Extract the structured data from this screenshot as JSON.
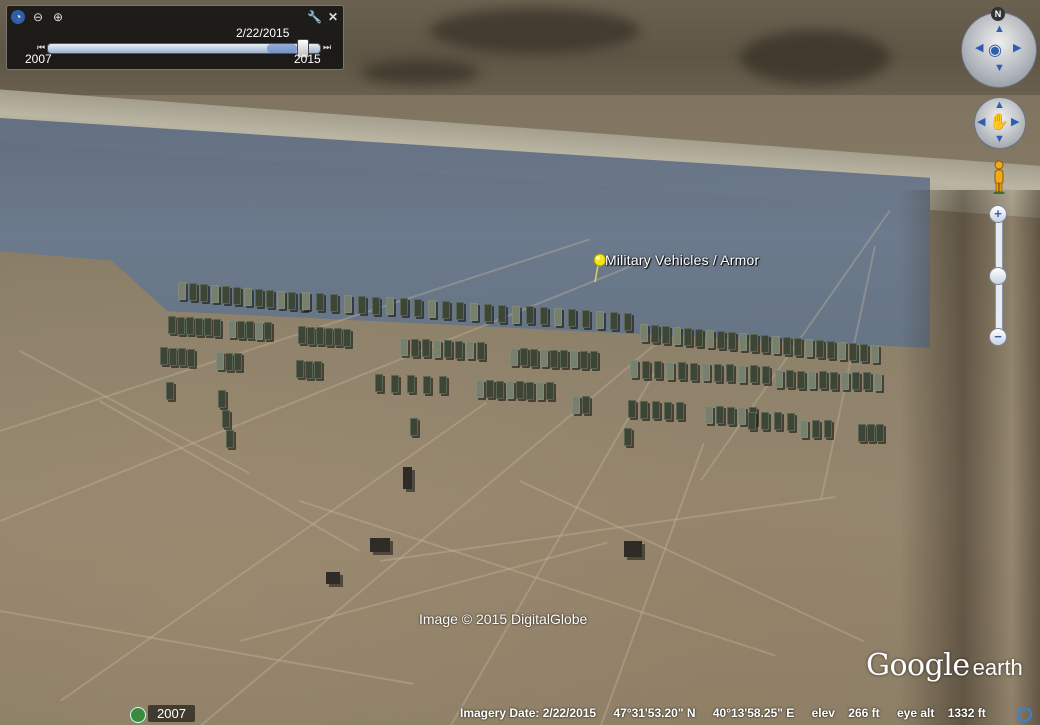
{
  "time_slider": {
    "current_date": "2/22/2015",
    "range_start_year": "2007",
    "range_end_year": "2015",
    "position_fraction": 0.95,
    "start_glyph": "⏮",
    "end_glyph": "⏭"
  },
  "toolbar": {
    "clock_glyph": "◔",
    "zoom_out_glyph": "⊖",
    "zoom_in_glyph": "⊕",
    "wrench_glyph": "🔧",
    "close_glyph": "✕"
  },
  "placemark": {
    "label": "Military Vehicles / Armor",
    "color": "#f2e51a"
  },
  "navigation": {
    "north_label": "N",
    "zoom_in_label": "+",
    "zoom_out_label": "−",
    "zoom_level_fraction": 0.5
  },
  "credits": {
    "copyright": "Image © 2015 DigitalGlobe",
    "brand_google": "Google",
    "brand_earth": "earth"
  },
  "status_bar": {
    "historical_year": "2007",
    "imagery_date": "Imagery Date: 2/22/2015",
    "latitude": "47°31'53.20\" N",
    "longitude": "40°13'58.25\" E",
    "elevation": "elev    266 ft",
    "eye_altitude": "eye alt    1332 ft"
  },
  "colors": {
    "accent": "#2d5fb0",
    "panel_bg": "#0a0a0c",
    "pin": "#f2e51a"
  }
}
